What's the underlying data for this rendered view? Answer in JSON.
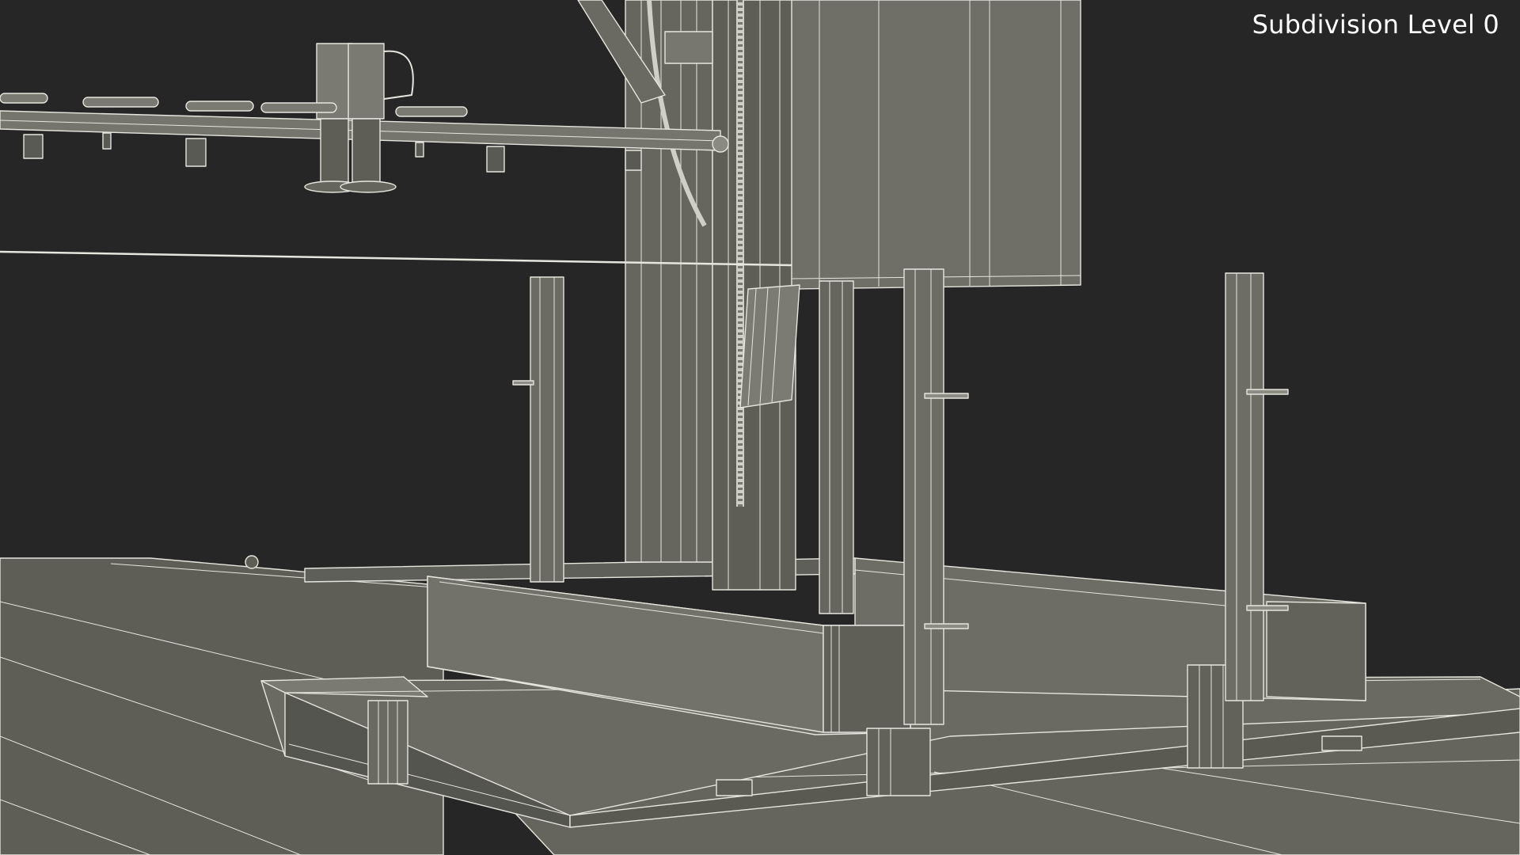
{
  "viewport": {
    "overlay_label": "Subdivision Level 0",
    "background_color": "#262626"
  },
  "scene": {
    "render_mode": "wireframe-on-shaded",
    "surface_color": "#6f6f67",
    "surface_dark_color": "#5c5c55",
    "wire_color": "#e9e9e2"
  }
}
